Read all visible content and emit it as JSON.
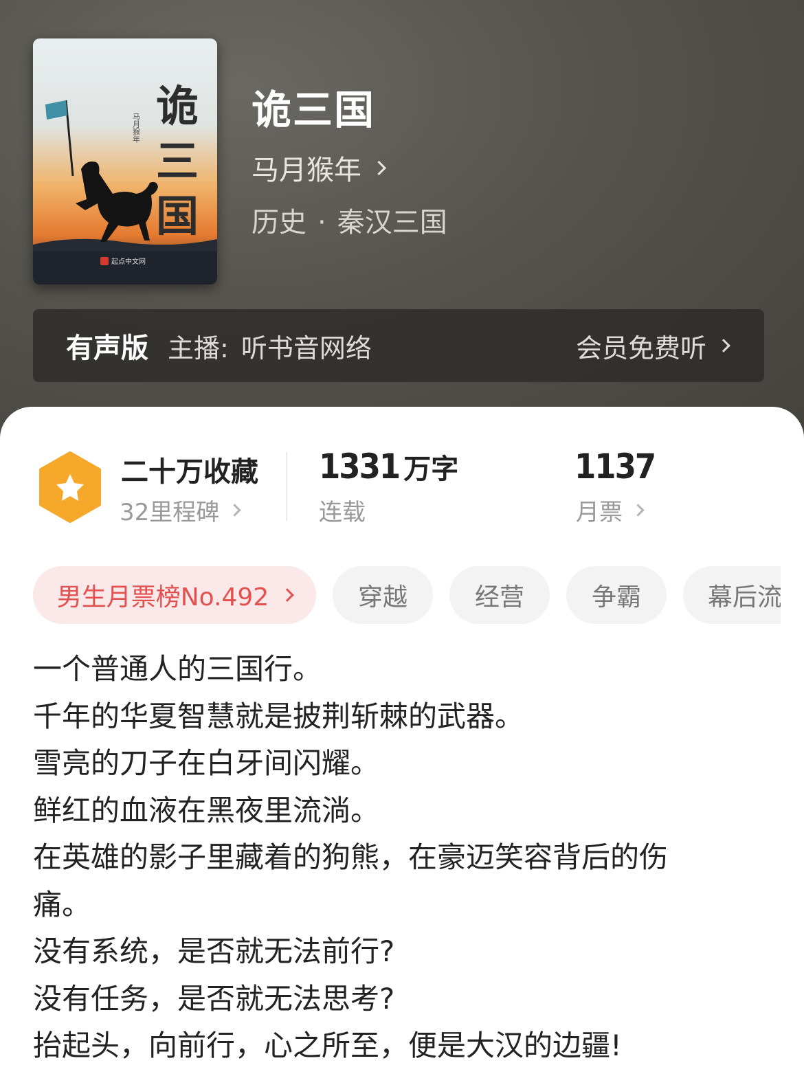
{
  "book": {
    "title": "诡三国",
    "author": "马月猴年",
    "category": "历史",
    "subcategory": "秦汉三国",
    "genre_separator": "·",
    "cover": {
      "title_text": "诡三国",
      "author_text": "马月猴年",
      "publisher_text": "起点中文网"
    }
  },
  "audio": {
    "label": "有声版",
    "anchor_label": "主播:",
    "anchor_name": "听书音网络",
    "free_label": "会员免费听"
  },
  "stats": {
    "collect_title": "二十万收藏",
    "milestones": "32里程碑",
    "word_count_number": "1331",
    "word_count_unit": "万字",
    "status": "连载",
    "monthly_votes": "1137",
    "monthly_votes_label": "月票"
  },
  "tags": {
    "rank": "男生月票榜No.492",
    "items": [
      "穿越",
      "经营",
      "争霸",
      "幕后流"
    ]
  },
  "description": [
    "一个普通人的三国行。",
    "千年的华夏智慧就是披荆斩棘的武器。",
    "雪亮的刀子在白牙间闪耀。",
    "鲜红的血液在黑夜里流淌。",
    "在英雄的影子里藏着的狗熊，在豪迈笑容背后的伤",
    "痛。",
    "没有系统，是否就无法前行?",
    "没有任务，是否就无法思考?",
    "抬起头，向前行，心之所至，便是大汉的边疆!"
  ],
  "colors": {
    "hero_bg": "#55534d",
    "rank_tag_bg": "#fbe8e8",
    "rank_tag_text": "#e45050",
    "badge_orange": "#f6a82a"
  }
}
